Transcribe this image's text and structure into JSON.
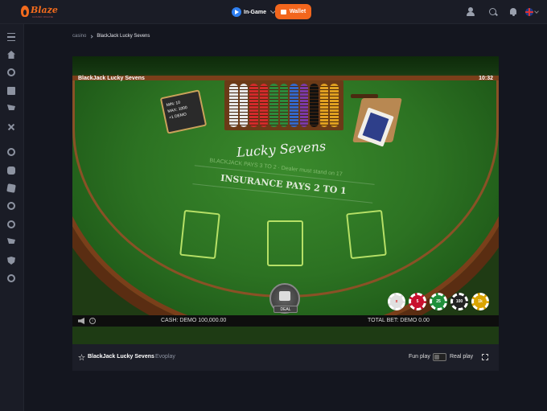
{
  "header": {
    "logo": {
      "word": "Blaze",
      "tagline": "CASINO ONLINE"
    },
    "in_game_label": "In-Game",
    "wallet_label": "Wallet"
  },
  "breadcrumb": {
    "home": "casino",
    "current": "BlackJack Lucky Sevens"
  },
  "game": {
    "title": "BlackJack Lucky Sevens",
    "clock": "10:32",
    "limit_sign": {
      "min": "MIN: 10",
      "max": "MAX: 1000",
      "demo": "+1 DEMO"
    },
    "table_logo": "Lucky Sevens",
    "pays_text": "BLACKJACK PAYS 3 TO 2 · Dealer must stand on 17",
    "insurance_text": "INSURANCE PAYS 2 TO 1",
    "deal_label": "DEAL",
    "chips": [
      {
        "label": "x",
        "color": "#e0e0e0",
        "text_color": "#d22"
      },
      {
        "label": "5",
        "color": "#c8102e",
        "text_color": "#fff"
      },
      {
        "label": "25",
        "color": "#1f8f3a",
        "text_color": "#fff"
      },
      {
        "label": "100",
        "color": "#222222",
        "text_color": "#fff"
      },
      {
        "label": "1k",
        "color": "#d9a400",
        "text_color": "#fff"
      }
    ],
    "rack_colors": [
      "#e8e8e8",
      "#e8e8e8",
      "#d22b2b",
      "#d22b2b",
      "#2c8a3c",
      "#2c8a3c",
      "#3467c9",
      "#7a3aa8",
      "#111111",
      "#e0a020",
      "#e0a020"
    ],
    "cash": "CASH: DEMO 100,000.00",
    "total_bet": "TOTAL BET: DEMO 0.00"
  },
  "footer": {
    "title": "BlackJack Lucky Sevens",
    "provider": "Evoplay",
    "fun_play": "Fun play",
    "real_play": "Real play"
  },
  "colors": {
    "accent": "#f2661d",
    "in_game_blue": "#2e7ff1"
  }
}
